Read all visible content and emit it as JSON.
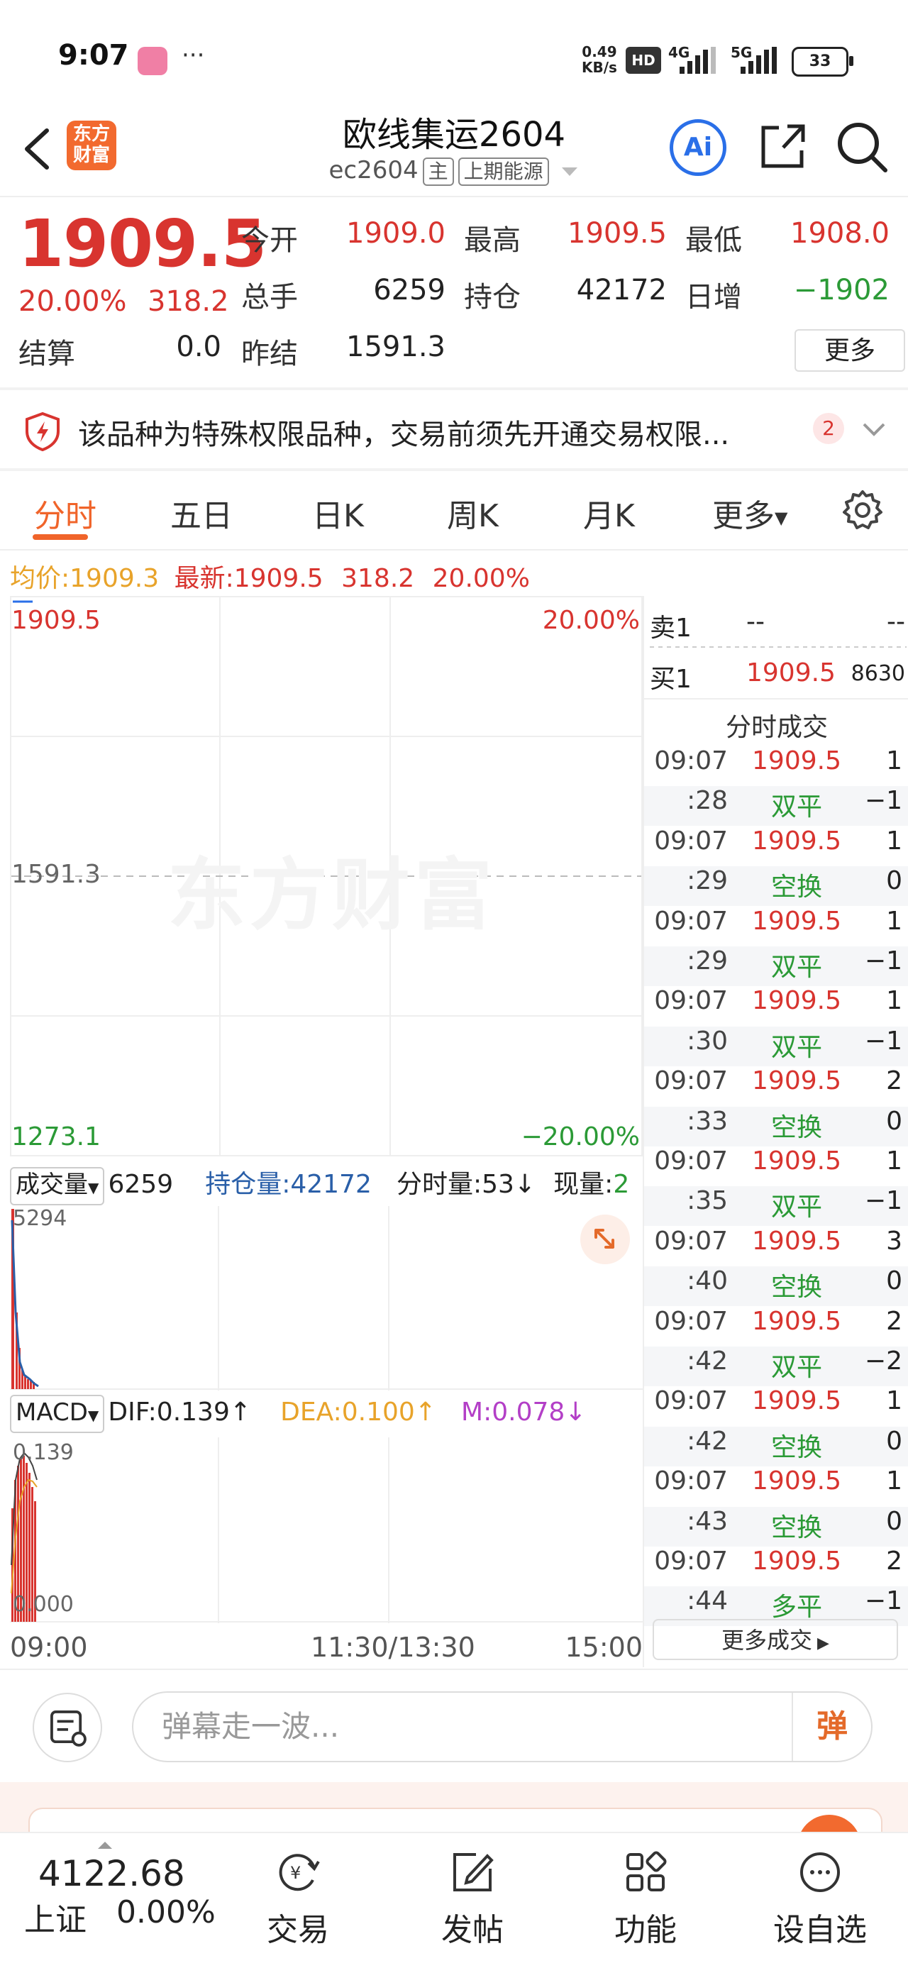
{
  "status_bar": {
    "time": "9:07",
    "more": "···",
    "net_speed_value": "0.49",
    "net_speed_unit": "KB/s",
    "hd": "HD",
    "net1": "4G",
    "net2": "5G",
    "battery": "33"
  },
  "header": {
    "logo_line1": "东方",
    "logo_line2": "财富",
    "title": "欧线集运2604",
    "code": "ec2604",
    "tag_main": "主",
    "exchange": "上期能源",
    "ai_label": "Ai"
  },
  "quote": {
    "price": "1909.5",
    "change_pct": "20.00%",
    "change": "318.2",
    "open_label": "今开",
    "open": "1909.0",
    "high_label": "最高",
    "high": "1909.5",
    "low_label": "最低",
    "low": "1908.0",
    "vol_label": "总手",
    "vol": "6259",
    "oi_label": "持仓",
    "oi": "42172",
    "daily_label": "日增",
    "daily": "−1902",
    "settle_label": "结算",
    "settle": "0.0",
    "prev_settle_label": "昨结",
    "prev_settle": "1591.3",
    "more": "更多"
  },
  "notice": {
    "text": "该品种为特殊权限品种，交易前须先开通交易权限...",
    "count": "2"
  },
  "tabs": [
    "分时",
    "五日",
    "日K",
    "周K",
    "月K",
    "更多"
  ],
  "intraday": {
    "avg_label": "均价:",
    "avg": "1909.3",
    "latest_label": "最新:",
    "latest": "1909.5",
    "latest_chg": "318.2",
    "latest_pct": "20.00%",
    "top_price": "1909.5",
    "top_pct": "20.00%",
    "mid_price": "1591.3",
    "bottom_price": "1273.1",
    "bottom_pct": "−20.00%",
    "watermark": "东方财富"
  },
  "volume": {
    "selector": "成交量",
    "total": "6259",
    "oi_text": "持仓量:42172",
    "min_vol_text": "分时量:53",
    "now_label": "现量:",
    "now": "2",
    "axis_top": "5294"
  },
  "macd": {
    "selector": "MACD",
    "dif_text": "DIF:0.139",
    "dea_text": "DEA:0.100",
    "m_text": "M:0.078",
    "axis_top": "0.139",
    "axis_bottom": "0.000"
  },
  "time_axis": [
    "09:00",
    "11:30/13:30",
    "15:00"
  ],
  "order_book": {
    "sell_label": "卖1",
    "sell_price": "--",
    "sell_vol": "--",
    "buy_label": "买1",
    "buy_price": "1909.5",
    "buy_vol": "8630",
    "ticks_title": "分时成交"
  },
  "ticks": [
    {
      "time": "09:07",
      "price": "1909.5",
      "vol": "1"
    },
    {
      "time": ":28",
      "price": "双平",
      "vol": "−1"
    },
    {
      "time": "09:07",
      "price": "1909.5",
      "vol": "1"
    },
    {
      "time": ":29",
      "price": "空换",
      "vol": "0"
    },
    {
      "time": "09:07",
      "price": "1909.5",
      "vol": "1"
    },
    {
      "time": ":29",
      "price": "双平",
      "vol": "−1"
    },
    {
      "time": "09:07",
      "price": "1909.5",
      "vol": "1"
    },
    {
      "time": ":30",
      "price": "双平",
      "vol": "−1"
    },
    {
      "time": "09:07",
      "price": "1909.5",
      "vol": "2"
    },
    {
      "time": ":33",
      "price": "空换",
      "vol": "0"
    },
    {
      "time": "09:07",
      "price": "1909.5",
      "vol": "1"
    },
    {
      "time": ":35",
      "price": "双平",
      "vol": "−1"
    },
    {
      "time": "09:07",
      "price": "1909.5",
      "vol": "3"
    },
    {
      "time": ":40",
      "price": "空换",
      "vol": "0"
    },
    {
      "time": "09:07",
      "price": "1909.5",
      "vol": "2"
    },
    {
      "time": ":42",
      "price": "双平",
      "vol": "−2"
    },
    {
      "time": "09:07",
      "price": "1909.5",
      "vol": "1"
    },
    {
      "time": ":42",
      "price": "空换",
      "vol": "0"
    },
    {
      "time": "09:07",
      "price": "1909.5",
      "vol": "1"
    },
    {
      "time": ":43",
      "price": "空换",
      "vol": "0"
    },
    {
      "time": "09:07",
      "price": "1909.5",
      "vol": "2"
    },
    {
      "time": ":44",
      "price": "多平",
      "vol": "−1"
    }
  ],
  "more_deals": "更多成交",
  "danmu": {
    "placeholder": "弹幕走一波...",
    "send": "弹"
  },
  "bottom_nav": {
    "index_value": "4122.68",
    "index_name": "上证",
    "index_pct": "0.00%",
    "items": [
      "交易",
      "发帖",
      "功能",
      "设自选"
    ]
  },
  "colors": {
    "up": "#d8342f",
    "down": "#2b9a36",
    "accent": "#f0642a",
    "ai_blue": "#2a6fe8"
  }
}
